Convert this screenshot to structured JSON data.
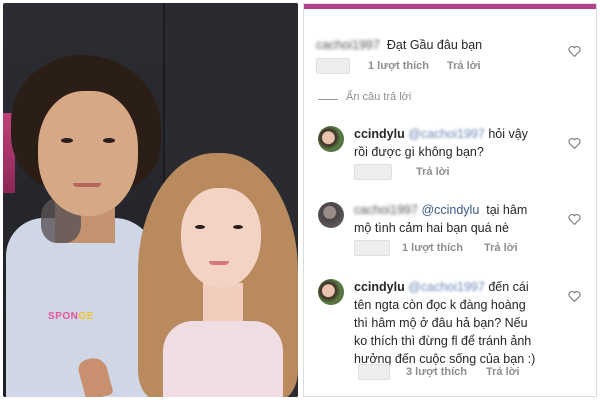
{
  "photo": {
    "hoodie_print_a": "SPON",
    "hoodie_print_b": "GE"
  },
  "comments": [
    {
      "username": "cachoi1997",
      "text": "Đạt Gầu đâu bạn",
      "likes": "1 lượt thích",
      "reply": "Trả lời"
    },
    {
      "hide_replies": "Ẩn câu trả lời"
    },
    {
      "username": "ccindylu",
      "mention": "@cachoi1997",
      "text_line1": "hỏi vậy",
      "text_line2": "rồi được gì không bạn?",
      "reply": "Trả lời"
    },
    {
      "username": "cachoi1997",
      "mention": "@ccindylu",
      "text_line1": "tại hâm",
      "text_line2": "mộ tình cảm hai bạn quá nè",
      "likes": "1 lượt thích",
      "reply": "Trả lời"
    },
    {
      "username": "ccindylu",
      "mention": "@cachoi1997",
      "text_line1": "đến cái",
      "text_line2": "tên ngta còn đọc k đàng hoàng",
      "text_line3": "thì hâm mộ ở đâu hả bạn? Nếu",
      "text_line4": "ko thích thì đừng fl để tránh ảnh",
      "text_line5": "hưởng đến cuộc sống của bạn :)",
      "likes": "3 lượt thích",
      "reply": "Trả lời"
    }
  ],
  "colors": {
    "accent_top": "#b5418e",
    "mention": "#3b5a8a",
    "meta": "#8e8e8e"
  },
  "icons": [
    "heart-icon"
  ]
}
